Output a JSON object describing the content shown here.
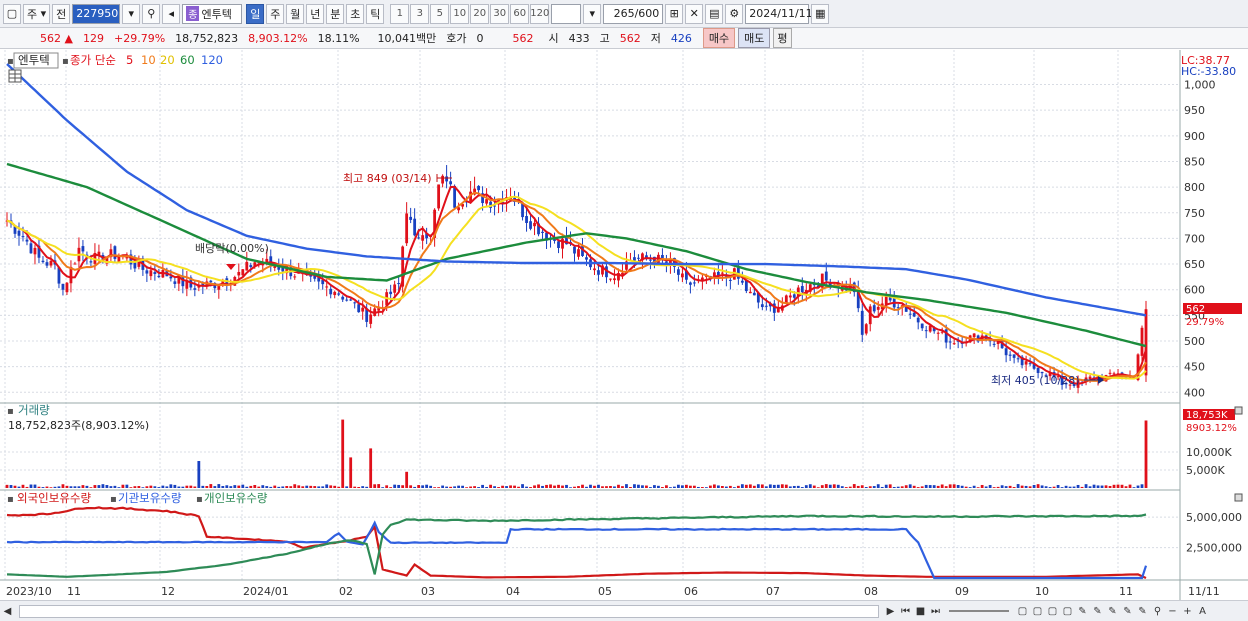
{
  "toolbar": {
    "menu_code": "주",
    "prev_label": "전",
    "stock_code": "227950",
    "stock_tag": "종",
    "stock_name": "엔투텍",
    "periods": [
      "일",
      "주",
      "월",
      "년",
      "분",
      "초",
      "틱"
    ],
    "period_active": "일",
    "ticks": [
      "1",
      "3",
      "5",
      "10",
      "20",
      "30",
      "60",
      "120"
    ],
    "count_display": "265",
    "count_total": "/600",
    "date": "2024/11/11"
  },
  "quote": {
    "price": "562",
    "change": "129",
    "change_pct": "+29.79%",
    "volume": "18,752,823",
    "volume_pct": "8,903.12%",
    "turnover": "18.11%",
    "amount": "10,041백만",
    "hoga_label": "호가",
    "hoga_value": "0",
    "hoga_price": "562",
    "open_label": "시",
    "open": "433",
    "high_label": "고",
    "high": "562",
    "low_label": "저",
    "low": "426",
    "buy_label": "매수",
    "sell_label": "매도",
    "flat_label": "평"
  },
  "legend": {
    "name": "엔투텍",
    "ma_label": "종가 단순",
    "ma_periods": [
      "5",
      "10",
      "20",
      "60",
      "120"
    ]
  },
  "colors": {
    "up": "#e0101a",
    "down": "#1840c0",
    "ma5": "#e0101a",
    "ma10": "#f07a1a",
    "ma20": "#f5e020",
    "ma60": "#1c8c3c",
    "ma120": "#3060e0",
    "foreign": "#d01818",
    "institution": "#3060e0",
    "individual": "#2e8b57"
  },
  "annotations": {
    "high": "최고 849 (03/14)",
    "low": "최저 405 (10/28)",
    "dividend": "배당락(0.00%)",
    "lc": "LC:38.77",
    "hc": "HC:-33.80",
    "last_price_tag": "562",
    "last_pct_tag": "29.79%",
    "vol_tag": "18,753K",
    "vol_pct_tag": "8903.12%"
  },
  "volume_panel": {
    "title": "거래량",
    "value": "18,752,823주(8,903.12%)"
  },
  "ownership_panel": {
    "series": [
      "외국인보유수량",
      "기관보유수량",
      "개인보유수량"
    ]
  },
  "chart_data": [
    {
      "type": "candlestick",
      "title": "엔투텍",
      "y_ticks": [
        400,
        450,
        500,
        550,
        600,
        650,
        700,
        750,
        800,
        850,
        900,
        950,
        1000
      ],
      "y_tick_labels": [
        "400",
        "450",
        "500",
        "550",
        "600",
        "650",
        "700",
        "750",
        "800",
        "850",
        "900",
        "950",
        "1,000"
      ],
      "ylim": [
        385,
        1040
      ],
      "x_labels": [
        "2023/10",
        "11",
        "12",
        "2024/01",
        "02",
        "03",
        "04",
        "05",
        "06",
        "07",
        "08",
        "09",
        "10",
        "11",
        "11/11"
      ],
      "close_path": [
        [
          0,
          735
        ],
        [
          4,
          705
        ],
        [
          8,
          660
        ],
        [
          12,
          645
        ],
        [
          14,
          600
        ],
        [
          18,
          680
        ],
        [
          22,
          660
        ],
        [
          28,
          670
        ],
        [
          34,
          640
        ],
        [
          40,
          630
        ],
        [
          46,
          605
        ],
        [
          52,
          612
        ],
        [
          58,
          630
        ],
        [
          62,
          655
        ],
        [
          66,
          650
        ],
        [
          70,
          640
        ],
        [
          76,
          615
        ],
        [
          82,
          600
        ],
        [
          86,
          575
        ],
        [
          90,
          548
        ],
        [
          94,
          575
        ],
        [
          98,
          610
        ],
        [
          100,
          760
        ],
        [
          102,
          695
        ],
        [
          104,
          720
        ],
        [
          106,
          700
        ],
        [
          108,
          800
        ],
        [
          110,
          820
        ],
        [
          112,
          770
        ],
        [
          116,
          790
        ],
        [
          122,
          770
        ],
        [
          126,
          790
        ],
        [
          130,
          740
        ],
        [
          136,
          700
        ],
        [
          140,
          690
        ],
        [
          144,
          660
        ],
        [
          148,
          640
        ],
        [
          152,
          630
        ],
        [
          156,
          660
        ],
        [
          162,
          660
        ],
        [
          166,
          650
        ],
        [
          170,
          610
        ],
        [
          176,
          620
        ],
        [
          182,
          630
        ],
        [
          186,
          590
        ],
        [
          190,
          560
        ],
        [
          194,
          570
        ],
        [
          198,
          600
        ],
        [
          204,
          620
        ],
        [
          208,
          610
        ],
        [
          212,
          600
        ],
        [
          214,
          510
        ],
        [
          216,
          560
        ],
        [
          220,
          580
        ],
        [
          224,
          570
        ],
        [
          228,
          540
        ],
        [
          232,
          520
        ],
        [
          236,
          500
        ],
        [
          240,
          505
        ],
        [
          244,
          510
        ],
        [
          248,
          495
        ],
        [
          252,
          460
        ],
        [
          256,
          450
        ],
        [
          260,
          440
        ],
        [
          264,
          418
        ],
        [
          268,
          418
        ],
        [
          272,
          430
        ],
        [
          276,
          430
        ],
        [
          278,
          440
        ],
        [
          280,
          425
        ],
        [
          282,
          433
        ],
        [
          285,
          562
        ]
      ],
      "high": {
        "value": 849,
        "date": "03/14"
      },
      "low": {
        "value": 405,
        "date": "10/28"
      },
      "last": 562,
      "ma_series": [
        {
          "name": "5",
          "color": "#e0101a"
        },
        {
          "name": "10",
          "color": "#f07a1a"
        },
        {
          "name": "20",
          "color": "#f5e020"
        },
        {
          "name": "60",
          "color": "#1c8c3c",
          "values_path": [
            [
              0,
              845
            ],
            [
              20,
              800
            ],
            [
              40,
              730
            ],
            [
              60,
              660
            ],
            [
              80,
              625
            ],
            [
              95,
              618
            ],
            [
              110,
              660
            ],
            [
              130,
              692
            ],
            [
              145,
              710
            ],
            [
              155,
              700
            ],
            [
              170,
              675
            ],
            [
              185,
              640
            ],
            [
              200,
              615
            ],
            [
              215,
              595
            ],
            [
              230,
              580
            ],
            [
              250,
              555
            ],
            [
              270,
              520
            ],
            [
              285,
              490
            ]
          ]
        },
        {
          "name": "120",
          "color": "#3060e0",
          "values_path": [
            [
              0,
              1040
            ],
            [
              15,
              930
            ],
            [
              30,
              830
            ],
            [
              45,
              755
            ],
            [
              60,
              705
            ],
            [
              75,
              680
            ],
            [
              90,
              665
            ],
            [
              110,
              655
            ],
            [
              130,
              652
            ],
            [
              150,
              652
            ],
            [
              170,
              650
            ],
            [
              190,
              650
            ],
            [
              210,
              645
            ],
            [
              225,
              640
            ],
            [
              240,
              620
            ],
            [
              260,
              585
            ],
            [
              285,
              550
            ]
          ]
        }
      ]
    },
    {
      "type": "bar",
      "title": "거래량",
      "y_ticks": [
        5000,
        10000
      ],
      "y_tick_labels": [
        "5,000K",
        "10,000K"
      ],
      "ylim": [
        0,
        20000
      ],
      "spikes": [
        {
          "x": 48,
          "value": 7500
        },
        {
          "x": 84,
          "value": 19000
        },
        {
          "x": 86,
          "value": 8500
        },
        {
          "x": 91,
          "value": 11000
        },
        {
          "x": 100,
          "value": 4500
        },
        {
          "x": 285,
          "value": 18753
        }
      ]
    },
    {
      "type": "line",
      "title": "보유수량",
      "y_ticks": [
        2500000,
        5000000
      ],
      "y_tick_labels": [
        "2,500,000",
        "5,000,000"
      ],
      "ylim": [
        0,
        6000000
      ],
      "series": [
        {
          "name": "외국인보유수량",
          "color": "#d01818",
          "values_path": [
            [
              0,
              5150000
            ],
            [
              10,
              5250000
            ],
            [
              20,
              5800000
            ],
            [
              30,
              5700000
            ],
            [
              40,
              5500000
            ],
            [
              48,
              5100000
            ],
            [
              50,
              3400000
            ],
            [
              60,
              3200000
            ],
            [
              70,
              3000000
            ],
            [
              74,
              2500000
            ],
            [
              80,
              2800000
            ],
            [
              86,
              3100000
            ],
            [
              90,
              3400000
            ],
            [
              92,
              4200000
            ],
            [
              94,
              700000
            ],
            [
              100,
              200000
            ],
            [
              102,
              1100000
            ],
            [
              106,
              200000
            ],
            [
              120,
              50000
            ],
            [
              140,
              100000
            ],
            [
              160,
              350000
            ],
            [
              180,
              450000
            ],
            [
              200,
              400000
            ],
            [
              215,
              200000
            ],
            [
              230,
              100000
            ],
            [
              260,
              100000
            ],
            [
              283,
              300000
            ],
            [
              285,
              0
            ]
          ]
        },
        {
          "name": "기관보유수량",
          "color": "#3060e0",
          "values_path": [
            [
              0,
              2950000
            ],
            [
              80,
              2950000
            ],
            [
              83,
              3700000
            ],
            [
              85,
              3000000
            ],
            [
              89,
              2750000
            ],
            [
              92,
              4500000
            ],
            [
              93,
              3800000
            ],
            [
              96,
              2900000
            ],
            [
              125,
              2900000
            ],
            [
              126,
              4000000
            ],
            [
              225,
              4000000
            ],
            [
              228,
              2900000
            ],
            [
              232,
              0
            ],
            [
              284,
              0
            ],
            [
              285,
              1000000
            ]
          ]
        },
        {
          "name": "개인보유수량",
          "color": "#2e8b57",
          "values_path": [
            [
              0,
              300000
            ],
            [
              15,
              100000
            ],
            [
              25,
              250000
            ],
            [
              40,
              500000
            ],
            [
              55,
              1100000
            ],
            [
              70,
              2000000
            ],
            [
              80,
              2800000
            ],
            [
              86,
              3100000
            ],
            [
              90,
              2800000
            ],
            [
              92,
              300000
            ],
            [
              94,
              3600000
            ],
            [
              96,
              4400000
            ],
            [
              100,
              4800000
            ],
            [
              120,
              4700000
            ],
            [
              160,
              4900000
            ],
            [
              200,
              5100000
            ],
            [
              230,
              5050000
            ],
            [
              284,
              5100000
            ],
            [
              285,
              5200000
            ]
          ]
        }
      ]
    }
  ]
}
